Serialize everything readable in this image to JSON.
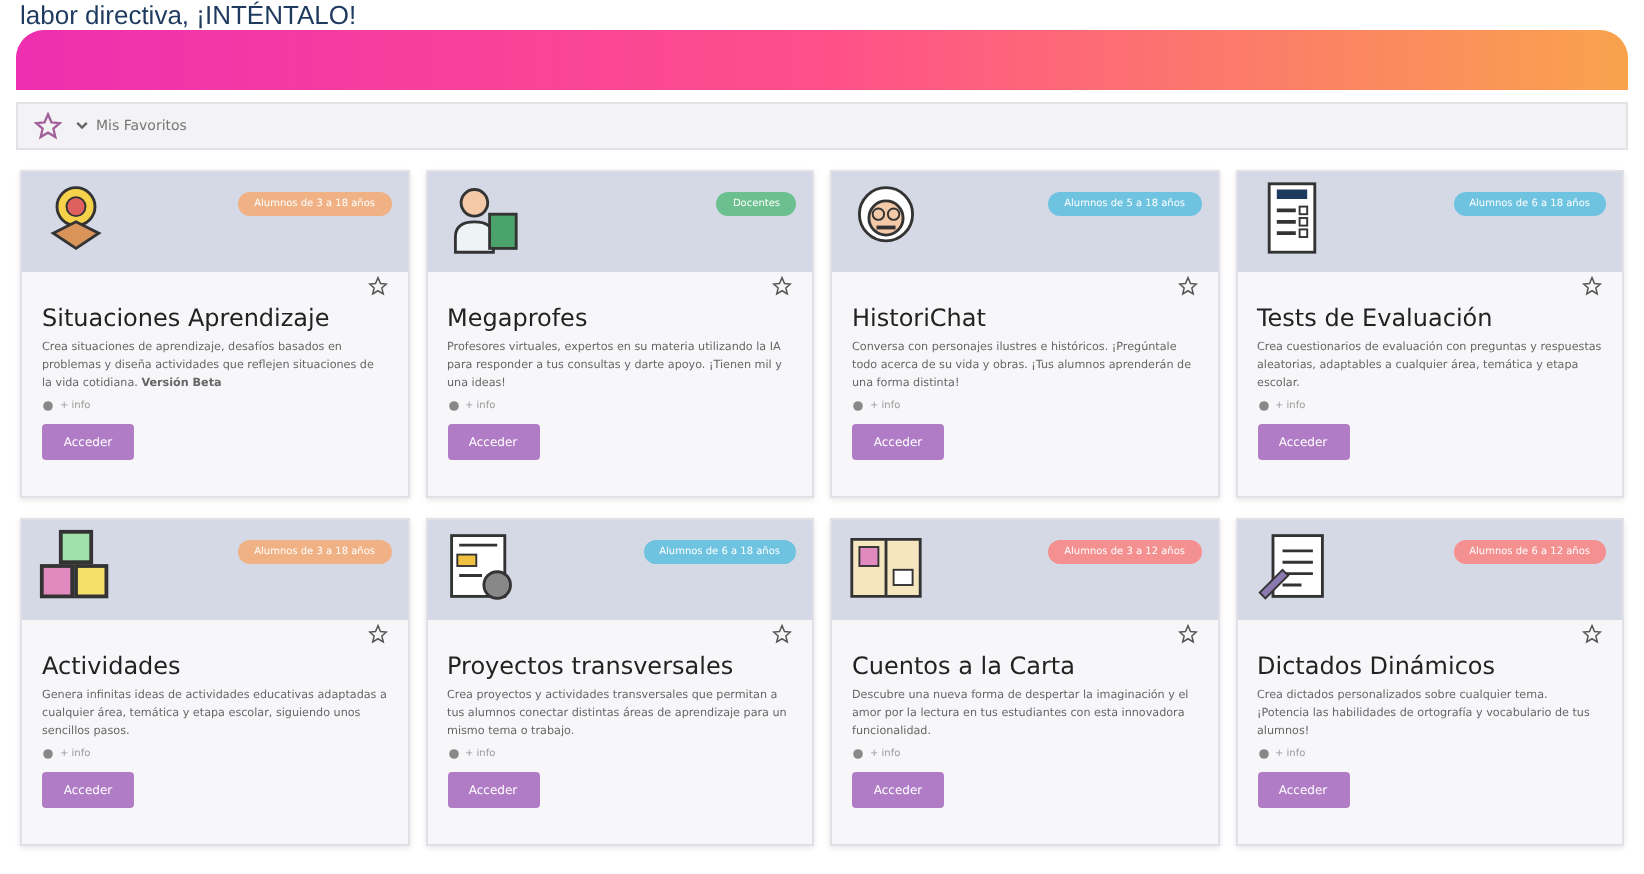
{
  "top_caption": "labor directiva, ¡INTÉNTALO!",
  "favorites_bar": {
    "label": "Mis Favoritos",
    "expanded": true
  },
  "cards": [
    {
      "title": "Situaciones Aprendizaje",
      "badge": "Alumnos de 3 a 18 años",
      "color": "#f0b184",
      "favorite": false,
      "description": "Crea situaciones de aprendizaje, desafíos basados en problemas y diseña actividades que reflejen situaciones de la vida cotidiana. **Versión Beta**",
      "meta": "+ info",
      "button": "Acceder"
    },
    {
      "title": "Megaprofes",
      "badge": "Docentes",
      "color": "#6cc08f",
      "favorite": false,
      "description": "Profesores virtuales, expertos en su materia utilizando la IA para responder a tus consultas y darte apoyo. ¡Tienen mil y una ideas!",
      "meta": "+ info",
      "button": "Acceder"
    },
    {
      "title": "HistoriChat",
      "badge": "Alumnos de 5 a 18 años",
      "color": "#6ec3e0",
      "favorite": false,
      "description": "Conversa con personajes ilustres e históricos. ¡Pregúntale todo acerca de su vida y obras. ¡Tus alumnos aprenderán de una forma distinta!",
      "meta": "+ info",
      "button": "Acceder"
    },
    {
      "title": "Tests de Evaluación",
      "badge": "Alumnos de 6 a 18 años",
      "color": "#6ec3e0",
      "favorite": false,
      "description": "Crea cuestionarios de evaluación con preguntas y respuestas aleatorias, adaptables a cualquier área, temática y etapa escolar.",
      "meta": "+ info",
      "button": "Acceder"
    },
    {
      "title": "Actividades",
      "badge": "Alumnos de 3 a 18 años",
      "color": "#f0b184",
      "favorite": false,
      "description": "Genera infinitas ideas de actividades educativas adaptadas a cualquier área, temática y etapa escolar, siguiendo unos sencillos pasos.",
      "meta": "+ info",
      "button": "Acceder"
    },
    {
      "title": "Proyectos transversales",
      "badge": "Alumnos de 6 a 18 años",
      "color": "#6ec3e0",
      "favorite": false,
      "description": "Crea proyectos y actividades transversales que permitan a tus alumnos conectar distintas áreas de aprendizaje para un mismo tema o trabajo.",
      "meta": "+ info",
      "button": "Acceder"
    },
    {
      "title": "Cuentos a la Carta",
      "badge": "Alumnos de 3 a 12 años",
      "color": "#f49090",
      "favorite": false,
      "description": "Descubre una nueva forma de despertar la imaginación y el amor por la lectura en tus estudiantes con esta innovadora funcionalidad.",
      "meta": "+ info",
      "button": "Acceder"
    },
    {
      "title": "Dictados Dinámicos",
      "badge": "Alumnos de 6 a 12 años",
      "color": "#f49090",
      "favorite": false,
      "description": "Crea dictados personalizados sobre cualquier tema. ¡Potencia las habilidades de ortografía y vocabulario de tus alumnos!",
      "meta": "+ info",
      "button": "Acceder"
    }
  ]
}
